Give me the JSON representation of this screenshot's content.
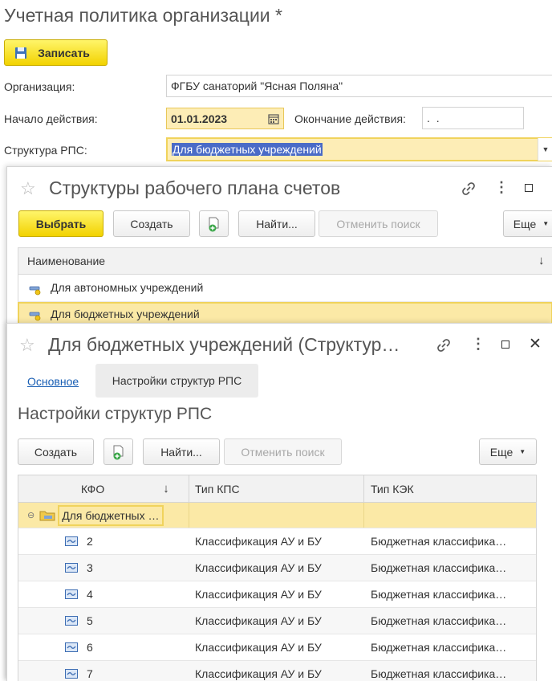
{
  "main_form": {
    "title": "Учетная политика организации *",
    "save_button": "Записать",
    "organization_label": "Организация:",
    "organization_value": "ФГБУ санаторий \"Ясная Поляна\"",
    "start_label": "Начало действия:",
    "start_value": "01.01.2023",
    "end_label": "Окончание действия:",
    "end_value": " .  .",
    "structure_label": "Структура РПС:",
    "structure_value": "Для бюджетных учреждений"
  },
  "selection_window": {
    "title": "Структуры рабочего плана счетов",
    "toolbar": {
      "select": "Выбрать",
      "create": "Создать",
      "find": "Найти...",
      "cancel_search": "Отменить поиск",
      "more": "Еще"
    },
    "column_header": "Наименование",
    "items": [
      {
        "label": "Для автономных учреждений"
      },
      {
        "label": "Для бюджетных учреждений"
      }
    ]
  },
  "detail_window": {
    "title": "Для бюджетных учреждений (Структур…",
    "tabs": [
      {
        "label": "Основное"
      },
      {
        "label": "Настройки структур РПС"
      }
    ],
    "section_title": "Настройки структур РПС",
    "toolbar": {
      "create": "Создать",
      "find": "Найти...",
      "cancel_search": "Отменить поиск",
      "more": "Еще"
    },
    "columns": [
      "КФО",
      "Тип КПС",
      "Тип КЭК"
    ],
    "group_row": "Для бюджетных …",
    "rows": [
      {
        "kfo": "2",
        "kps": "Классификация АУ и БУ",
        "kek": "Бюджетная классифика…"
      },
      {
        "kfo": "3",
        "kps": "Классификация АУ и БУ",
        "kek": "Бюджетная классифика…"
      },
      {
        "kfo": "4",
        "kps": "Классификация АУ и БУ",
        "kek": "Бюджетная классифика…"
      },
      {
        "kfo": "5",
        "kps": "Классификация АУ и БУ",
        "kek": "Бюджетная классифика…"
      },
      {
        "kfo": "6",
        "kps": "Классификация АУ и БУ",
        "kek": "Бюджетная классифика…"
      },
      {
        "kfo": "7",
        "kps": "Классификация АУ и БУ",
        "kek": "Бюджетная классифика…"
      }
    ]
  },
  "colors": {
    "accent_yellow": "#f5dc00",
    "selected_row": "#fbe9a6",
    "link_blue": "#1a5fb4",
    "text_selection": "#4a6bc7"
  }
}
